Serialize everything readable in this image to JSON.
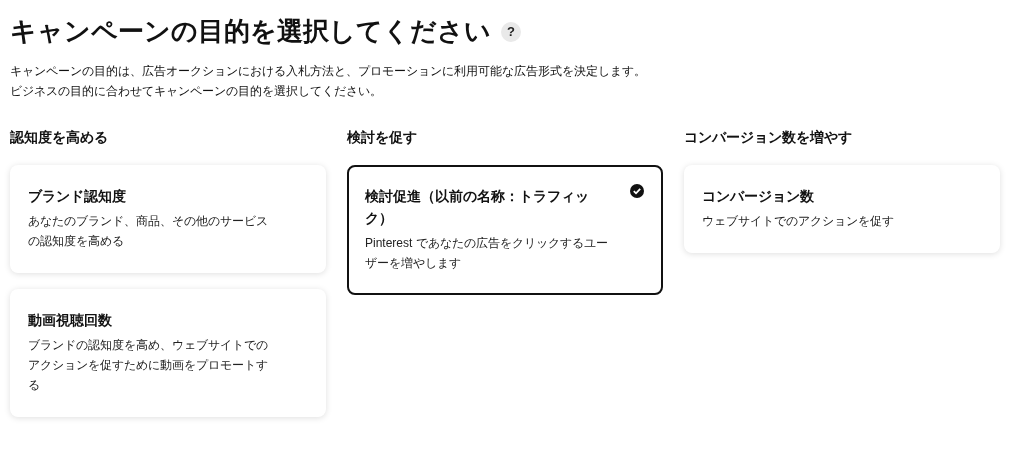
{
  "header": {
    "title": "キャンペーンの目的を選択してください",
    "help": "?",
    "description": [
      "キャンペーンの目的は、広告オークションにおける入札方法と、プロモーションに利用可能な広告形式を決定します。",
      "ビジネスの目的に合わせてキャンペーンの目的を選択してください。"
    ]
  },
  "columns": [
    {
      "heading": "認知度を高める",
      "cards": [
        {
          "title": "ブランド認知度",
          "description": "あなたのブランド、商品、その他のサービスの認知度を高める",
          "selected": false
        },
        {
          "title": "動画視聴回数",
          "description": "ブランドの認知度を高め、ウェブサイトでのアクションを促すために動画をプロモートする",
          "selected": false
        }
      ]
    },
    {
      "heading": "検討を促す",
      "cards": [
        {
          "title": "検討促進（以前の名称：トラフィック）",
          "description": "Pinterest であなたの広告をクリックするユーザーを増やします",
          "selected": true
        }
      ]
    },
    {
      "heading": "コンバージョン数を増やす",
      "cards": [
        {
          "title": "コンバージョン数",
          "description": "ウェブサイトでのアクションを促す",
          "selected": false
        }
      ]
    }
  ]
}
